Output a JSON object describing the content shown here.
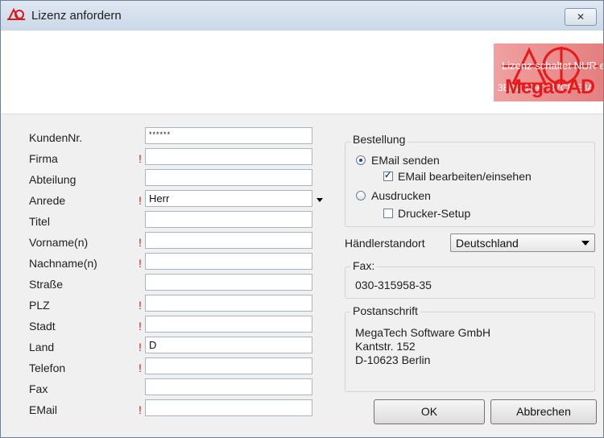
{
  "window": {
    "title": "Lizenz anfordern",
    "close_glyph": "✕"
  },
  "logo": {
    "line1": "Lizenz schaltet NUR e",
    "line2": "3E87 539C B7C8 E3A",
    "brand": "MegaCAD",
    "color": "#e8181b"
  },
  "form": {
    "kunden_nr": {
      "label": "KundenNr.",
      "value": "******"
    },
    "firma": {
      "label": "Firma",
      "required": "!",
      "value": ""
    },
    "abteilung": {
      "label": "Abteilung",
      "value": ""
    },
    "anrede": {
      "label": "Anrede",
      "required": "!",
      "value": "Herr"
    },
    "titel": {
      "label": "Titel",
      "value": ""
    },
    "vorname": {
      "label": "Vorname(n)",
      "required": "!",
      "value": ""
    },
    "nachname": {
      "label": "Nachname(n)",
      "required": "!",
      "value": ""
    },
    "strasse": {
      "label": "Straße",
      "value": ""
    },
    "plz": {
      "label": "PLZ",
      "required": "!",
      "value": ""
    },
    "stadt": {
      "label": "Stadt",
      "required": "!",
      "value": ""
    },
    "land": {
      "label": "Land",
      "required": "!",
      "value": "D"
    },
    "telefon": {
      "label": "Telefon",
      "required": "!",
      "value": ""
    },
    "fax": {
      "label": "Fax",
      "value": ""
    },
    "email": {
      "label": "EMail",
      "required": "!",
      "value": ""
    }
  },
  "bestellung": {
    "legend": "Bestellung",
    "email_senden": {
      "label": "EMail senden",
      "checked": true
    },
    "email_bearbeiten": {
      "label": "EMail bearbeiten/einsehen",
      "checked": true
    },
    "ausdrucken": {
      "label": "Ausdrucken",
      "checked": false
    },
    "drucker_setup": {
      "label": "Drucker-Setup",
      "checked": false
    }
  },
  "haendler": {
    "label": "Händlerstandort",
    "value": "Deutschland"
  },
  "fax_box": {
    "legend": "Fax:",
    "value": "030-315958-35"
  },
  "postanschrift": {
    "legend": "Postanschrift",
    "line1": "MegaTech Software GmbH",
    "line2": "Kantstr. 152",
    "line3": "D-10623 Berlin"
  },
  "buttons": {
    "ok": "OK",
    "cancel": "Abbrechen"
  },
  "icons": {
    "app": "megacad-logo-icon",
    "close": "close-icon",
    "dropdown": "chevron-down-icon"
  }
}
